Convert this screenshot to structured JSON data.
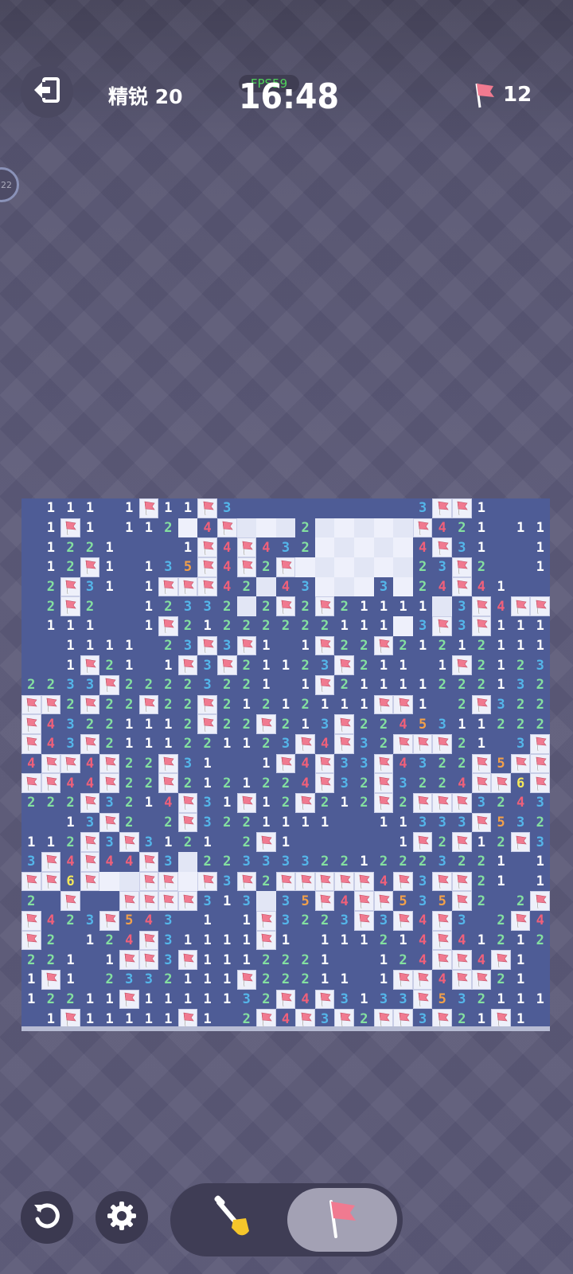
{
  "header": {
    "mode_label": "精锐 20",
    "fps_label": "FPS59",
    "timer": "16:48",
    "flags_remaining": "12",
    "side_badge": "22"
  },
  "icons": {
    "back": "exit-arrow-icon",
    "flag": "flag-icon",
    "restart": "restart-icon",
    "settings": "gear-icon",
    "dig": "shovel-icon"
  },
  "board": {
    "cols": 27,
    "rows": 27,
    "colors": {
      "hidden": "#4e5c96",
      "open": "#eef0fb",
      "n1": "#ffffff",
      "n2": "#84e0a0",
      "n3": "#54b6ea",
      "n4": "#f0607a",
      "n5": "#f2a04a",
      "n6": "#f4e85a",
      "flag": "#f07a90"
    },
    "legend": "Row strings: '.' hidden, ' ' revealed empty, 'F' flag, digits = mine counts",
    "rows_data": [
      ".111.1F11F3.........3FF1...",
      ".1F1.112 4F   2     F421.11",
      ".1221...1F4F432     4F31..1F",
      ".12F1.135F4F2F      23F2..11",
      ".2F31.1FFF42 43   3 24F41...",
      ".2F2..12332 2F2F21111 3F4FF21.",
      ".111..1F21222222111 3F3F1111",
      "..1111.23F3F1.1F22F21212111F",
      "..1F21.1F3F21123F211.1F2123 33",
      "2233F22223221.1F21111222132 F3",
      "FF2F22F22F21212111FF1.2F322",
      "F43221112F22F213F224531122221",
      "F43F2111221123F4F32FFF21.3F5F",
      "4FF4F22F31..1F4F33F4322F5FFF",
      "FF44F22F2121224F32F3224FF6F",
      "222F3214F31F12F212F2FFF3243F",
      "..13F2.2F3221111..11333F5321.3F",
      "112F3F3121.2F1.....1F2F12F3",
      "3F4F44F3 2233332212223221.12F3",
      "FF6F  FF F3F2FFFFF4F3FF21.124F",
      "2.F..FFFF313 35F4FF535F2.2F5F",
      "F423F543.1.1F3223F3F4F3.2F4F",
      "F2.124F31111F1.111214F4121221",
      "221.1FF3F1112221..124FF4F1.11",
      "1F1.2332111F22211.1FF4FF21.1F",
      "12211F1111132F4F3133F532111111",
      ".1F11111F1.2F4F3F2FF3F21F1...."
    ]
  }
}
